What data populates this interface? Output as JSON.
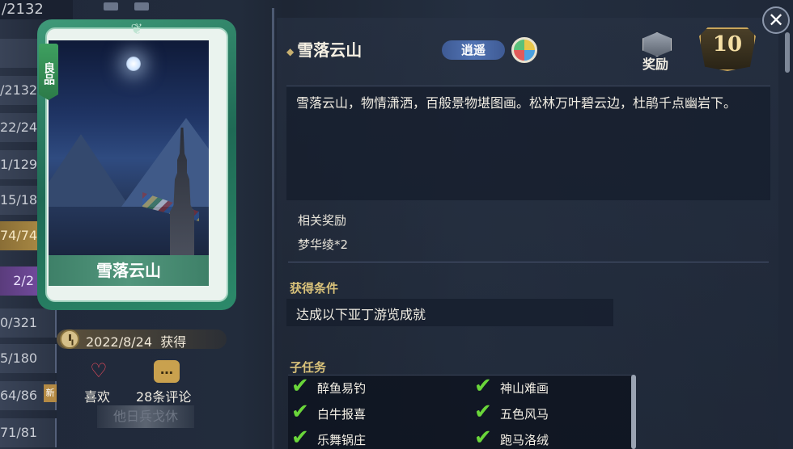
{
  "sidebar": {
    "top_counter": "/2132",
    "rows": [
      {
        "value": ""
      },
      {
        "value": "/2132"
      },
      {
        "value": "22/24"
      },
      {
        "value": "1/129"
      },
      {
        "value": "15/18"
      },
      {
        "value": "74/74"
      },
      {
        "value": "2/2"
      },
      {
        "value": "0/321"
      },
      {
        "value": "5/180"
      },
      {
        "value": "64/86"
      },
      {
        "value": "71/81"
      }
    ],
    "badge": "新"
  },
  "card": {
    "rarity": "良品",
    "title": "雪落云山",
    "crest": "❦"
  },
  "obtained": {
    "date": "2022/8/24",
    "label": "获得"
  },
  "actions": {
    "like_label": "喜欢",
    "comments_label": "28条评论",
    "comments_icon": "…",
    "motto": "他日兵戈休"
  },
  "detail": {
    "name": "雪落云山",
    "tag": "逍遥",
    "reward_label": "奖励",
    "level": "10",
    "description": "雪落云山，物情潇洒，百般景物堪图画。松林万叶碧云边，杜鹃千点幽岩下。",
    "related_rewards_label": "相关奖励",
    "related_rewards_value": "梦华绫*2",
    "condition_label": "获得条件",
    "condition_text": "达成以下亚丁游览成就",
    "subtasks_label": "子任务",
    "subtasks": [
      "醉鱼易钓",
      "神山难画",
      "白牛报喜",
      "五色风马",
      "乐舞锅庄",
      "跑马洛绒"
    ]
  },
  "close_icon": "✕",
  "colors": {
    "check": "#6ad63a",
    "accent_gold": "#d9c27a",
    "card_green": "#3f9a79"
  }
}
